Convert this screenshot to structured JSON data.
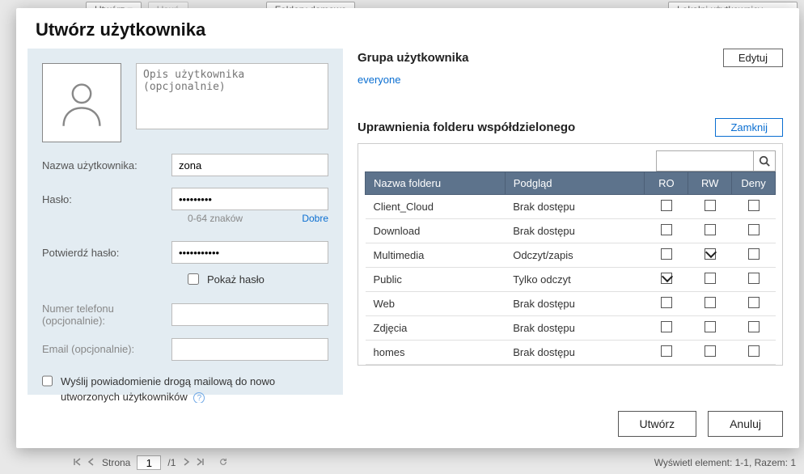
{
  "bg": {
    "btn_create": "Utwórz ▾",
    "btn_delete": "Usuń",
    "btn_home": "Foldery domowe",
    "select_local": "Lokalni użytkownicy",
    "pager_page_label": "Strona",
    "pager_page": "1",
    "pager_total": "/1",
    "status": "Wyświetl element: 1-1, Razem: 1"
  },
  "modal": {
    "title": "Utwórz użytkownika",
    "left": {
      "desc_placeholder": "Opis użytkownika (opcjonalnie)",
      "username_label": "Nazwa użytkownika:",
      "username_value": "zona",
      "password_label": "Hasło:",
      "password_value": "•••••••••",
      "pw_range": "0-64 znaków",
      "pw_strength": "Dobre",
      "confirm_label": "Potwierdź hasło:",
      "confirm_value": "•••••••••••",
      "show_pw": "Pokaż hasło",
      "phone_label": "Numer telefonu (opcjonalnie):",
      "email_label": "Email (opcjonalnie):",
      "notify_label": "Wyślij powiadomienie drogą mailową do nowo utworzonych użytkowników"
    },
    "right": {
      "group_title": "Grupa użytkownika",
      "edit_btn": "Edytuj",
      "group_link": "everyone",
      "perm_title": "Uprawnienia folderu współdzielonego",
      "close_btn": "Zamknij",
      "cols": {
        "name": "Nazwa folderu",
        "preview": "Podgląd",
        "ro": "RO",
        "rw": "RW",
        "deny": "Deny"
      },
      "preview_labels": {
        "none": "Brak dostępu",
        "rw": "Odczyt/zapis",
        "ro": "Tylko odczyt"
      },
      "rows": [
        {
          "name": "Client_Cloud",
          "preview": "none",
          "ro": false,
          "rw": false,
          "deny": false
        },
        {
          "name": "Download",
          "preview": "none",
          "ro": false,
          "rw": false,
          "deny": false
        },
        {
          "name": "Multimedia",
          "preview": "rw",
          "ro": false,
          "rw": true,
          "deny": false
        },
        {
          "name": "Public",
          "preview": "ro",
          "ro": true,
          "rw": false,
          "deny": false
        },
        {
          "name": "Web",
          "preview": "none",
          "ro": false,
          "rw": false,
          "deny": false
        },
        {
          "name": "Zdjęcia",
          "preview": "none",
          "ro": false,
          "rw": false,
          "deny": false
        },
        {
          "name": "homes",
          "preview": "none",
          "ro": false,
          "rw": false,
          "deny": false
        }
      ]
    },
    "footer": {
      "create": "Utwórz",
      "cancel": "Anuluj"
    }
  }
}
